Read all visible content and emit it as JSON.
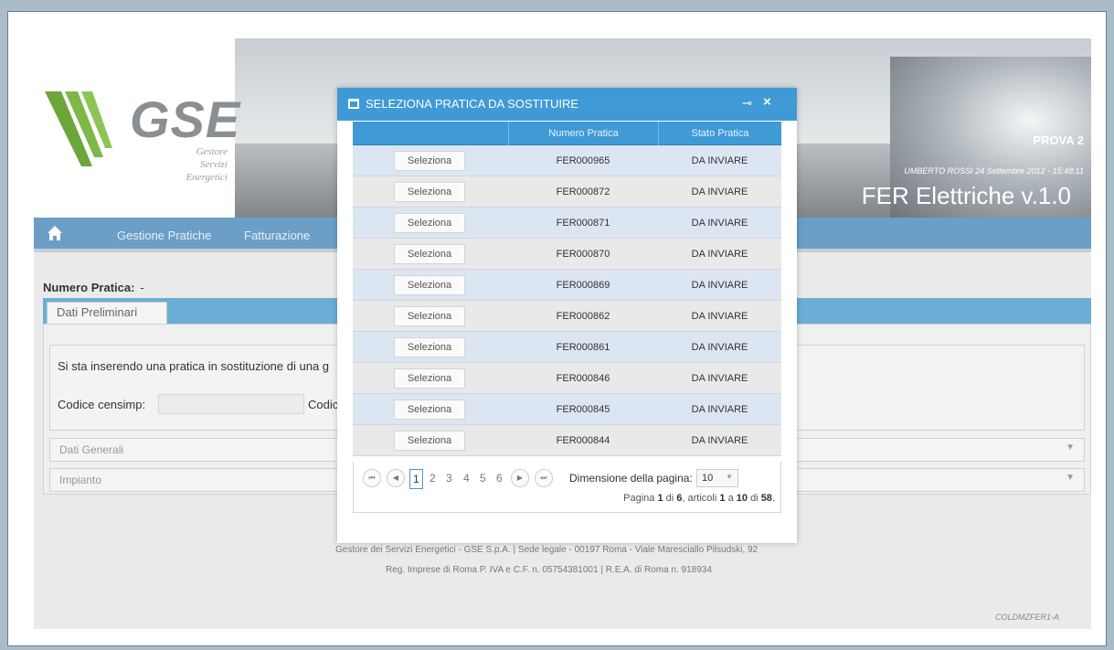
{
  "brand": {
    "logo_text": "GSE",
    "logo_sub": [
      "Gestore",
      "Servizi",
      "Energetici"
    ],
    "prova": "PROVA 2",
    "user_line": "UMBERTO ROSSI 24 Settembre 2012 - 15:48:11",
    "app_name": "FER Elettriche  v.1.0"
  },
  "nav": {
    "home_icon": "home-icon",
    "items": [
      "Gestione Pratiche",
      "Fatturazione"
    ]
  },
  "form": {
    "numero_label": "Numero Pratica:",
    "numero_value": "-",
    "tab": "Dati Preliminari",
    "info_text": "Si sta inserendo una pratica in sostituzione di una g",
    "codice_censimp_label": "Codice censimp:",
    "codice_censimp_value": "",
    "codic_label": "Codic",
    "accordion": [
      "Dati Generali",
      "Impianto"
    ]
  },
  "footer": {
    "line1": "Gestore dei Servizi Energetici - GSE S.p.A. | Sede legale - 00197 Roma - Viale Maresciallo Pilsudski, 92",
    "line2": "Reg. Imprese di Roma P. IVA e C.F. n. 05754381001 | R.E.A. di Roma n. 918934",
    "code": "COLDMZFER1-A"
  },
  "modal": {
    "title": "SELEZIONA PRATICA DA SOSTITUIRE",
    "columns": [
      "",
      "Numero Pratica",
      "Stato Pratica"
    ],
    "select_label": "Seleziona",
    "rows": [
      {
        "numero": "FER000965",
        "stato": "DA INVIARE"
      },
      {
        "numero": "FER000872",
        "stato": "DA INVIARE"
      },
      {
        "numero": "FER000871",
        "stato": "DA INVIARE"
      },
      {
        "numero": "FER000870",
        "stato": "DA INVIARE"
      },
      {
        "numero": "FER000869",
        "stato": "DA INVIARE"
      },
      {
        "numero": "FER000862",
        "stato": "DA INVIARE"
      },
      {
        "numero": "FER000861",
        "stato": "DA INVIARE"
      },
      {
        "numero": "FER000846",
        "stato": "DA INVIARE"
      },
      {
        "numero": "FER000845",
        "stato": "DA INVIARE"
      },
      {
        "numero": "FER000844",
        "stato": "DA INVIARE"
      }
    ],
    "pager": {
      "pages": [
        "1",
        "2",
        "3",
        "4",
        "5",
        "6"
      ],
      "current": "1",
      "page_size_label": "Dimensione della pagina:",
      "page_size": "10",
      "info_pagina": "Pagina",
      "info_page": "1",
      "info_di": "di",
      "info_total_pages": "6",
      "info_articoli": ", articoli",
      "info_from": "1",
      "info_a": "a",
      "info_to": "10",
      "info_di2": "di",
      "info_total": "58",
      "info_dot": "."
    }
  }
}
